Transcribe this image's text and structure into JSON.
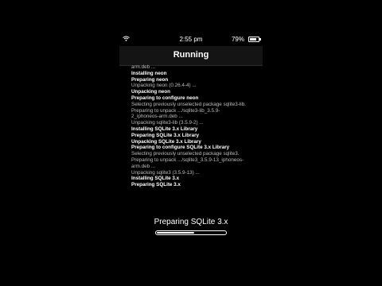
{
  "status_bar": {
    "wifi_icon": "wifi-icon",
    "time": "2:55 pm",
    "battery_percent": "79%",
    "battery_level": 0.79
  },
  "nav": {
    "title": "Running"
  },
  "log": [
    {
      "text": "arm.deb ...",
      "bold": false
    },
    {
      "text": "Installing neon",
      "bold": true
    },
    {
      "text": "Preparing neon",
      "bold": true
    },
    {
      "text": "Unpacking neon (0.26.4-4) ...",
      "bold": false
    },
    {
      "text": "Unpacking neon",
      "bold": true
    },
    {
      "text": "Preparing to configure neon",
      "bold": true
    },
    {
      "text": "Selecting previously unselected package sqlite3-lib.",
      "bold": false
    },
    {
      "text": "Preparing to unpack .../sqlite3-lib_3.5.9-",
      "bold": false
    },
    {
      "text": "2_iphoneos-arm.deb ...",
      "bold": false
    },
    {
      "text": "Unpacking sqlite3-lib (3.5.9-2) ...",
      "bold": false
    },
    {
      "text": "Installing SQLite 3.x Library",
      "bold": true
    },
    {
      "text": "Preparing SQLite 3.x Library",
      "bold": true
    },
    {
      "text": "Unpacking SQLite 3.x Library",
      "bold": true
    },
    {
      "text": "Preparing to configure SQLite 3.x Library",
      "bold": true
    },
    {
      "text": "Selecting previously unselected package sqlite3.",
      "bold": false
    },
    {
      "text": "Preparing to unpack .../sqlite3_3.5.9-13_iphoneos-",
      "bold": false
    },
    {
      "text": "arm.deb ...",
      "bold": false
    },
    {
      "text": "Unpacking sqlite3 (3.5.9-13) ...",
      "bold": false
    },
    {
      "text": "Installing SQLite 3.x",
      "bold": true
    },
    {
      "text": "Preparing SQLite 3.x",
      "bold": true
    }
  ],
  "progress": {
    "label": "Preparing SQLite 3.x",
    "fraction": 0.55
  }
}
